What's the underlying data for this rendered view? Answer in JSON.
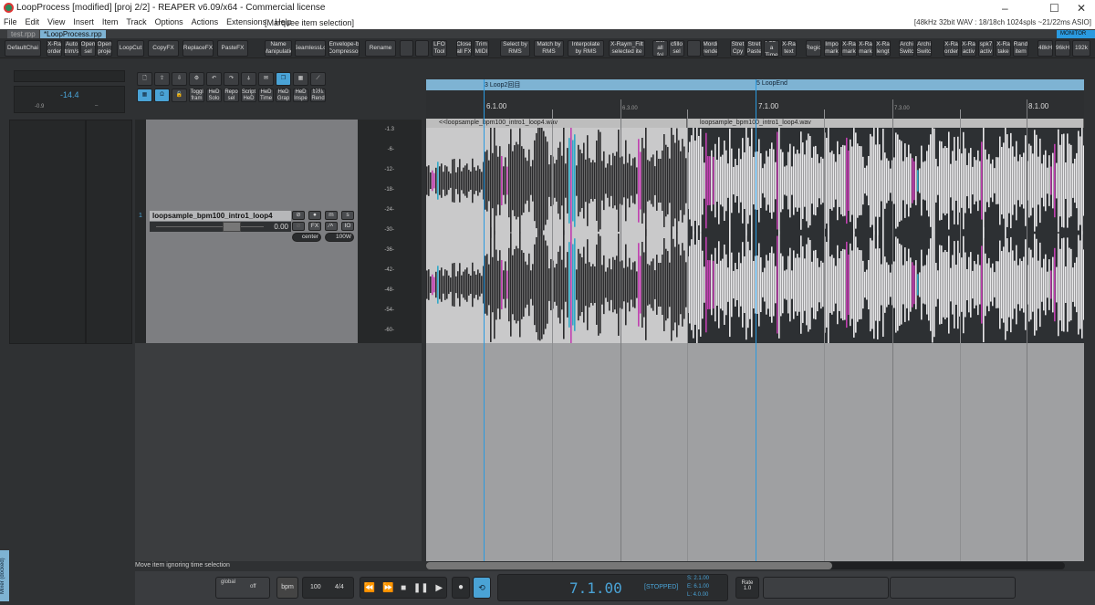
{
  "window": {
    "title": "LoopProcess [modified] [proj 2/2] - REAPER v6.09/x64 - Commercial license",
    "minimize": "–",
    "maximize": "☐",
    "close": "✕"
  },
  "menu": {
    "items": [
      "File",
      "Edit",
      "View",
      "Insert",
      "Item",
      "Track",
      "Options",
      "Actions",
      "Extensions",
      "Help"
    ],
    "status": "[Marquee item selection]",
    "audio_info": "[48kHz 32bit WAV : 18/18ch 1024spls ~21/22ms ASIO]"
  },
  "tabs": [
    {
      "label": "test.rpp"
    },
    {
      "label": "*LoopProcess.rpp"
    }
  ],
  "monitor_badge": "MONITOR FX",
  "toolbar": [
    "DefaultChai",
    "X-Ra order",
    "Auto trim/s",
    "Open sel",
    "Open proje",
    "LoopCut",
    "CopyFX",
    "ReplaceFX",
    "PasteFX",
    "Name Manipulatio",
    "SeamlessLo",
    "Envelope-b Compressor",
    "Rename",
    "",
    "",
    "LFO Tool",
    "Close all FX",
    "Trim MIDI",
    "Select by RMS",
    "Match by RMS",
    "Interpolate by RMS",
    "X-Raym_Filt selected ite",
    "Sel all fol",
    "cfillo sel",
    "",
    "Mordi rende",
    "Stret Cpy",
    "Stret Paste",
    "PL9-a Time",
    "X-Ra text",
    "Regio",
    "Impo mark",
    "X-Ra mark",
    "X-Ra mark",
    "X-Ra lengt",
    "Archi Switc",
    "Archi Switc",
    "X-Ra order",
    "X-Ra activ",
    "spk7 activ",
    "X-Ra take",
    "Rand item",
    "48kH",
    "96kH",
    "192k"
  ],
  "icon_toolbar_row2": [
    "",
    "",
    "",
    "Toggl fram",
    "HeD Solo",
    "Repo sel",
    "Script HeD",
    "HeD Time",
    "HeD Grap",
    "HeD Inspe",
    "ｶｽﾀﾑ Rend"
  ],
  "master": {
    "peak": "-14.4",
    "left": "-0.9",
    "right": "–"
  },
  "track": {
    "number": "1",
    "name": "loopsample_bpm100_intro1_loop4",
    "volume": "0.00",
    "pan": "center",
    "width": "100W",
    "buttons": {
      "fx": "FX",
      "io": "IO",
      "mute": "m",
      "solo": "s"
    }
  },
  "meter_scale": [
    "-1.3",
    "-6-",
    "-12-",
    "-18-",
    "-24-",
    "-30-",
    "-36-",
    "-42-",
    "-48-",
    "-54-",
    "-60-"
  ],
  "markers": [
    {
      "num": "3",
      "label": "Loop2回目"
    },
    {
      "num": "5",
      "label": "LoopEnd"
    }
  ],
  "ruler": [
    "6.1.00",
    "6.3.00",
    "7.1.00",
    "7.3.00",
    "8.1.00"
  ],
  "items": [
    {
      "name": "<<loopsample_bpm100_intro1_loop4.wav"
    },
    {
      "name": "loopsample_bpm100_intro1_loop4.wav"
    }
  ],
  "status_text": "Move item ignoring time selection",
  "mixer_tab": "Mixer (docked)",
  "transport": {
    "global": "global",
    "off": "off",
    "bpm_label": "bpm",
    "bpm": "100",
    "sig": "4/4",
    "position": "7.1.00",
    "state": "[STOPPED]",
    "sel_start": "S: 2.1.00",
    "sel_end": "E: 6.1.00",
    "sel_len": "L: 4.0.00",
    "rate_label": "Rate",
    "rate": "1.0"
  },
  "colors": {
    "accent": "#4aa3d6",
    "marker_lane": "#7eb3d3",
    "cursor": "#2a9ae0"
  }
}
